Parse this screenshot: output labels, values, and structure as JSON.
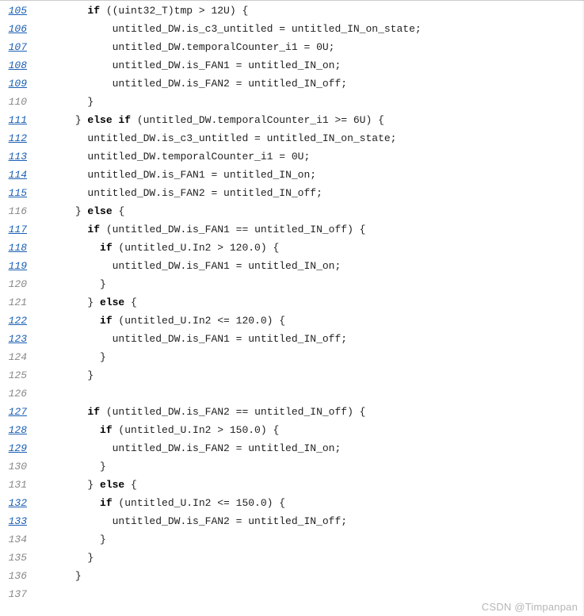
{
  "watermark": "CSDN @Timpanpan",
  "lines": [
    {
      "num": "105",
      "linked": true,
      "indent": 8,
      "tokens": [
        [
          "kw",
          "if"
        ],
        [
          "",
          " ((uint32_T)tmp > 12U) {"
        ]
      ]
    },
    {
      "num": "106",
      "linked": true,
      "indent": 12,
      "tokens": [
        [
          "",
          "untitled_DW.is_c3_untitled = untitled_IN_on_state;"
        ]
      ]
    },
    {
      "num": "107",
      "linked": true,
      "indent": 12,
      "tokens": [
        [
          "",
          "untitled_DW.temporalCounter_i1 = 0U;"
        ]
      ]
    },
    {
      "num": "108",
      "linked": true,
      "indent": 12,
      "tokens": [
        [
          "",
          "untitled_DW.is_FAN1 = untitled_IN_on;"
        ]
      ]
    },
    {
      "num": "109",
      "linked": true,
      "indent": 12,
      "tokens": [
        [
          "",
          "untitled_DW.is_FAN2 = untitled_IN_off;"
        ]
      ]
    },
    {
      "num": "110",
      "linked": false,
      "indent": 8,
      "tokens": [
        [
          "",
          "}"
        ]
      ]
    },
    {
      "num": "111",
      "linked": true,
      "indent": 6,
      "tokens": [
        [
          "",
          "} "
        ],
        [
          "kw",
          "else if"
        ],
        [
          "",
          " (untitled_DW.temporalCounter_i1 >= 6U) {"
        ]
      ]
    },
    {
      "num": "112",
      "linked": true,
      "indent": 8,
      "tokens": [
        [
          "",
          "untitled_DW.is_c3_untitled = untitled_IN_on_state;"
        ]
      ]
    },
    {
      "num": "113",
      "linked": true,
      "indent": 8,
      "tokens": [
        [
          "",
          "untitled_DW.temporalCounter_i1 = 0U;"
        ]
      ]
    },
    {
      "num": "114",
      "linked": true,
      "indent": 8,
      "tokens": [
        [
          "",
          "untitled_DW.is_FAN1 = untitled_IN_on;"
        ]
      ]
    },
    {
      "num": "115",
      "linked": true,
      "indent": 8,
      "tokens": [
        [
          "",
          "untitled_DW.is_FAN2 = untitled_IN_off;"
        ]
      ]
    },
    {
      "num": "116",
      "linked": false,
      "indent": 6,
      "tokens": [
        [
          "",
          "} "
        ],
        [
          "kw",
          "else"
        ],
        [
          "",
          " {"
        ]
      ]
    },
    {
      "num": "117",
      "linked": true,
      "indent": 8,
      "tokens": [
        [
          "kw",
          "if"
        ],
        [
          "",
          " (untitled_DW.is_FAN1 == untitled_IN_off) {"
        ]
      ]
    },
    {
      "num": "118",
      "linked": true,
      "indent": 10,
      "tokens": [
        [
          "kw",
          "if"
        ],
        [
          "",
          " (untitled_U.In2 > 120.0) {"
        ]
      ]
    },
    {
      "num": "119",
      "linked": true,
      "indent": 12,
      "tokens": [
        [
          "",
          "untitled_DW.is_FAN1 = untitled_IN_on;"
        ]
      ]
    },
    {
      "num": "120",
      "linked": false,
      "indent": 10,
      "tokens": [
        [
          "",
          "}"
        ]
      ]
    },
    {
      "num": "121",
      "linked": false,
      "indent": 8,
      "tokens": [
        [
          "",
          "} "
        ],
        [
          "kw",
          "else"
        ],
        [
          "",
          " {"
        ]
      ]
    },
    {
      "num": "122",
      "linked": true,
      "indent": 10,
      "tokens": [
        [
          "kw",
          "if"
        ],
        [
          "",
          " (untitled_U.In2 <= 120.0) {"
        ]
      ]
    },
    {
      "num": "123",
      "linked": true,
      "indent": 12,
      "tokens": [
        [
          "",
          "untitled_DW.is_FAN1 = untitled_IN_off;"
        ]
      ]
    },
    {
      "num": "124",
      "linked": false,
      "indent": 10,
      "tokens": [
        [
          "",
          "}"
        ]
      ]
    },
    {
      "num": "125",
      "linked": false,
      "indent": 8,
      "tokens": [
        [
          "",
          "}"
        ]
      ]
    },
    {
      "num": "126",
      "linked": false,
      "indent": 0,
      "tokens": [
        [
          "",
          ""
        ]
      ]
    },
    {
      "num": "127",
      "linked": true,
      "indent": 8,
      "tokens": [
        [
          "kw",
          "if"
        ],
        [
          "",
          " (untitled_DW.is_FAN2 == untitled_IN_off) {"
        ]
      ]
    },
    {
      "num": "128",
      "linked": true,
      "indent": 10,
      "tokens": [
        [
          "kw",
          "if"
        ],
        [
          "",
          " (untitled_U.In2 > 150.0) {"
        ]
      ]
    },
    {
      "num": "129",
      "linked": true,
      "indent": 12,
      "tokens": [
        [
          "",
          "untitled_DW.is_FAN2 = untitled_IN_on;"
        ]
      ]
    },
    {
      "num": "130",
      "linked": false,
      "indent": 10,
      "tokens": [
        [
          "",
          "}"
        ]
      ]
    },
    {
      "num": "131",
      "linked": false,
      "indent": 8,
      "tokens": [
        [
          "",
          "} "
        ],
        [
          "kw",
          "else"
        ],
        [
          "",
          " {"
        ]
      ]
    },
    {
      "num": "132",
      "linked": true,
      "indent": 10,
      "tokens": [
        [
          "kw",
          "if"
        ],
        [
          "",
          " (untitled_U.In2 <= 150.0) {"
        ]
      ]
    },
    {
      "num": "133",
      "linked": true,
      "indent": 12,
      "tokens": [
        [
          "",
          "untitled_DW.is_FAN2 = untitled_IN_off;"
        ]
      ]
    },
    {
      "num": "134",
      "linked": false,
      "indent": 10,
      "tokens": [
        [
          "",
          "}"
        ]
      ]
    },
    {
      "num": "135",
      "linked": false,
      "indent": 8,
      "tokens": [
        [
          "",
          "}"
        ]
      ]
    },
    {
      "num": "136",
      "linked": false,
      "indent": 6,
      "tokens": [
        [
          "",
          "}"
        ]
      ]
    },
    {
      "num": "137",
      "linked": false,
      "indent": 0,
      "tokens": [
        [
          "",
          ""
        ]
      ]
    }
  ]
}
